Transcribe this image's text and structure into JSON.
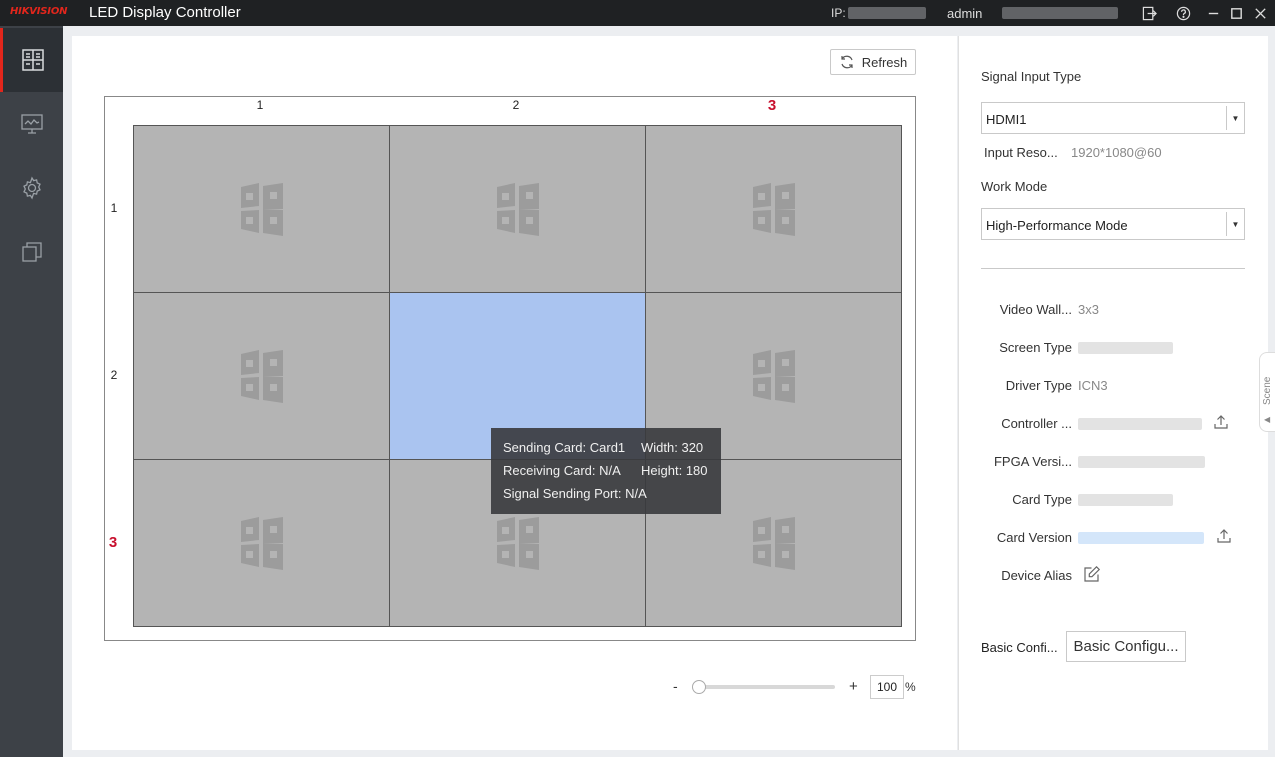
{
  "titlebar": {
    "logo": "HIKVISION",
    "title": "LED Display Controller",
    "ip_label": "IP:",
    "user": "admin",
    "icons": [
      "logout-icon",
      "help-icon",
      "minimize-icon",
      "maximize-icon",
      "close-icon"
    ]
  },
  "nav": {
    "items": [
      {
        "name": "layout-icon",
        "active": true
      },
      {
        "name": "monitor-icon",
        "active": false
      },
      {
        "name": "settings-icon",
        "active": false
      },
      {
        "name": "copy-icon",
        "active": false
      }
    ]
  },
  "toolbar": {
    "refresh_label": "Refresh"
  },
  "wall": {
    "columns": [
      "1",
      "2",
      "3"
    ],
    "rows": [
      "1",
      "2",
      "3"
    ],
    "highlight_column": "3",
    "highlight_row": "3",
    "selected_cell": {
      "row": 2,
      "col": 2
    }
  },
  "tooltip": {
    "sending_card_label": "Sending Card:",
    "sending_card_value": "Card1",
    "width_label": "Width:",
    "width_value": "320",
    "receiving_card_label": "Receiving Card:",
    "receiving_card_value": "N/A",
    "height_label": "Height:",
    "height_value": "180",
    "signal_port_label": "Signal Sending Port:",
    "signal_port_value": "N/A"
  },
  "zoom": {
    "minus": "-",
    "plus": "+",
    "value": "100",
    "unit": "%",
    "level_percent": 0
  },
  "settings": {
    "signal_input_type_label": "Signal Input Type",
    "signal_input_type_value": "HDMI1",
    "input_resolution_label": "Input Reso...",
    "input_resolution_value": "1920*1080@60",
    "work_mode_label": "Work Mode",
    "work_mode_value": "High-Performance Mode"
  },
  "info": {
    "video_wall_label": "Video Wall...",
    "video_wall_value": "3x3",
    "screen_type_label": "Screen Type",
    "driver_type_label": "Driver Type",
    "driver_type_value": "ICN3",
    "controller_label": "Controller ...",
    "fpga_label": "FPGA Versi...",
    "card_type_label": "Card Type",
    "card_version_label": "Card Version",
    "device_alias_label": "Device Alias"
  },
  "basic_config": {
    "label": "Basic Confi...",
    "button": "Basic Configu..."
  },
  "scene_tab": {
    "label": "Scene"
  }
}
